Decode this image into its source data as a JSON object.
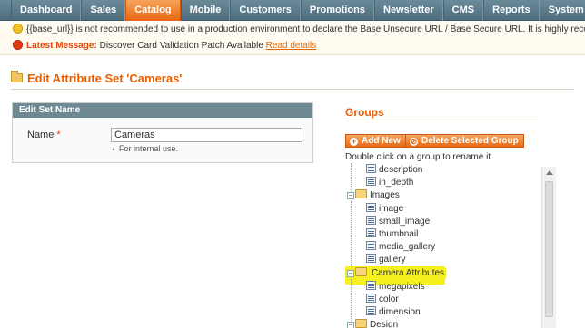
{
  "nav": {
    "items": [
      {
        "label": "Dashboard"
      },
      {
        "label": "Sales"
      },
      {
        "label": "Catalog"
      },
      {
        "label": "Mobile"
      },
      {
        "label": "Customers"
      },
      {
        "label": "Promotions"
      },
      {
        "label": "Newsletter"
      },
      {
        "label": "CMS"
      },
      {
        "label": "Reports"
      },
      {
        "label": "System"
      }
    ],
    "active": "Catalog"
  },
  "messages": {
    "warning": "{{base_url}} is not recommended to use in a production environment to declare the Base Unsecure URL / Base Secure URL. It is highly recommended to change this value in",
    "latest_label": "Latest Message:",
    "latest_text": "Discover Card Validation Patch Available",
    "latest_link": "Read details"
  },
  "page": {
    "title": "Edit Attribute Set 'Cameras'"
  },
  "edit_set": {
    "heading": "Edit Set Name",
    "name_label": "Name",
    "required_mark": "*",
    "name_value": "Cameras",
    "note": "For internal use."
  },
  "groups": {
    "title": "Groups",
    "add_button": "Add New",
    "delete_button": "Delete Selected Group",
    "hint": "Double click on a group to rename it",
    "tree": [
      {
        "label": "description"
      },
      {
        "label": "in_depth"
      },
      {
        "label": "Images"
      },
      {
        "label": "image"
      },
      {
        "label": "small_image"
      },
      {
        "label": "thumbnail"
      },
      {
        "label": "media_gallery"
      },
      {
        "label": "gallery"
      },
      {
        "label": "Camera Attributes"
      },
      {
        "label": "megapixels"
      },
      {
        "label": "color"
      },
      {
        "label": "dimension"
      },
      {
        "label": "Design"
      }
    ]
  },
  "colors": {
    "accent": "#eb5e00",
    "highlight": "#f6f01e",
    "nav_bg": "#5b7b8b"
  }
}
